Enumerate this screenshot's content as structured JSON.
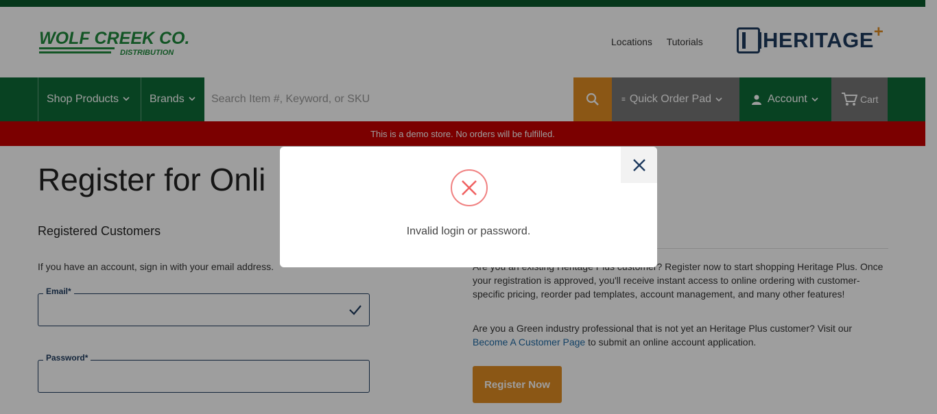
{
  "brand": {
    "logo_main": "WOLF CREEK CO.",
    "logo_sub": "DISTRIBUTION",
    "partner_logo": "HERITAGE",
    "partner_logo_plus": "+"
  },
  "header_links": [
    "Locations",
    "Tutorials"
  ],
  "nav": {
    "shop_products": "Shop Products",
    "brands": "Brands",
    "search_placeholder": "Search Item #, Keyword, or SKU",
    "quick_order_pad": "Quick Order Pad",
    "account": "Account",
    "cart": "Cart"
  },
  "demo_banner": "This is a demo store. No orders will be fulfilled.",
  "page": {
    "title": "Register for Onli",
    "section_title": "Registered Customers",
    "signin_text": "If you have an account, sign in with your email address.",
    "email_label": "Email*",
    "password_label": "Password*",
    "right_para1": "Are you an existing Heritage Plus customer? Register now to start shopping Heritage Plus. Once your registration is approved, you'll receive instant access to online ordering with customer-specific pricing, reorder pad templates, account management, and many other features!",
    "right_para2_pre": "Are you a Green industry professional that is not yet an Heritage Plus customer? Visit our ",
    "right_para2_link": "Become A Customer Page",
    "right_para2_post": " to submit an online account application.",
    "register_button": "Register Now"
  },
  "modal": {
    "message": "Invalid login or password.",
    "icon": "error-x-circle-icon"
  },
  "colors": {
    "green": "#0e6b38",
    "orange": "#e08d22",
    "red_banner": "#c70000",
    "navy": "#1d3a5e"
  }
}
